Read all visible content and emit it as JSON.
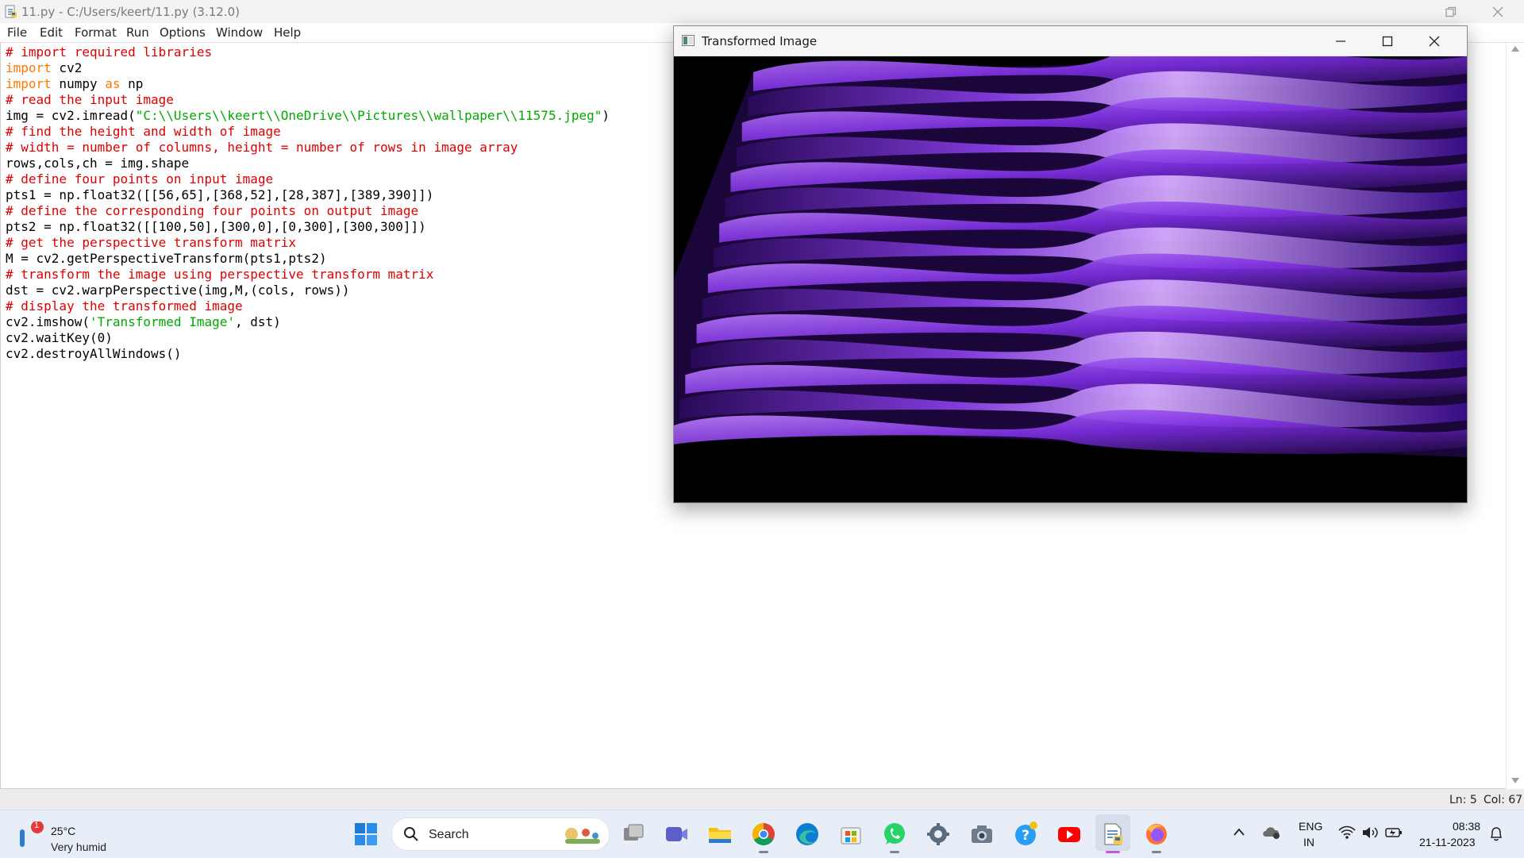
{
  "idle": {
    "title": "11.py - C:/Users/keert/11.py (3.12.0)",
    "menu": [
      "File",
      "Edit",
      "Format",
      "Run",
      "Options",
      "Window",
      "Help"
    ],
    "code": [
      [
        [
          "cmt",
          "# import required libraries"
        ]
      ],
      [
        [
          "kw",
          "import"
        ],
        [
          "txt",
          " cv2"
        ]
      ],
      [
        [
          "kw",
          "import"
        ],
        [
          "txt",
          " numpy "
        ],
        [
          "kw",
          "as"
        ],
        [
          "txt",
          " np"
        ]
      ],
      [
        [
          "cmt",
          "# read the input image"
        ]
      ],
      [
        [
          "txt",
          "img = cv2.imread("
        ],
        [
          "str",
          "\"C:\\\\Users\\\\keert\\\\OneDrive\\\\Pictures\\\\wallpaper\\\\11575.jpeg\""
        ],
        [
          "txt",
          ")"
        ]
      ],
      [
        [
          "cmt",
          "# find the height and width of image"
        ]
      ],
      [
        [
          "cmt",
          "# width = number of columns, height = number of rows in image array"
        ]
      ],
      [
        [
          "txt",
          "rows,cols,ch = img.shape"
        ]
      ],
      [
        [
          "cmt",
          "# define four points on input image"
        ]
      ],
      [
        [
          "txt",
          "pts1 = np.float32([[56,65],[368,52],[28,387],[389,390]])"
        ]
      ],
      [
        [
          "cmt",
          "# define the corresponding four points on output image"
        ]
      ],
      [
        [
          "txt",
          "pts2 = np.float32([[100,50],[300,0],[0,300],[300,300]])"
        ]
      ],
      [
        [
          "cmt",
          "# get the perspective transform matrix"
        ]
      ],
      [
        [
          "txt",
          "M = cv2.getPerspectiveTransform(pts1,pts2)"
        ]
      ],
      [
        [
          "cmt",
          "# transform the image using perspective transform matrix"
        ]
      ],
      [
        [
          "txt",
          "dst = cv2.warpPerspective(img,M,(cols, rows))"
        ]
      ],
      [
        [
          "cmt",
          "# display the transformed image"
        ]
      ],
      [
        [
          "txt",
          "cv2.imshow("
        ],
        [
          "str",
          "'Transformed Image'"
        ],
        [
          "txt",
          ", dst)"
        ]
      ],
      [
        [
          "txt",
          "cv2.waitKey(0)"
        ]
      ],
      [
        [
          "txt",
          "cv2.destroyAllWindows()"
        ]
      ]
    ],
    "status": {
      "ln": "Ln: 5",
      "col": "Col: 67"
    }
  },
  "cv_window": {
    "title": "Transformed Image"
  },
  "taskbar": {
    "weather": {
      "temp": "25°C",
      "condition": "Very humid",
      "badge": "1"
    },
    "search_label": "Search",
    "apps": [
      "start-icon",
      "search-icon",
      "task-view-icon",
      "teams-meet-icon",
      "file-explorer-icon",
      "chrome-icon",
      "edge-icon",
      "microsoft-store-icon",
      "whatsapp-icon",
      "settings-icon",
      "camera-icon",
      "help-icon",
      "youtube-icon",
      "idle-python-icon",
      "firefox-icon"
    ],
    "tray": {
      "lang_top": "ENG",
      "lang_bottom": "IN",
      "time": "08:38",
      "date": "21-11-2023"
    }
  },
  "colors": {
    "comment": "#dd0000",
    "keyword": "#ff7700",
    "string": "#00aa00",
    "taskbar_bg": "#e8eef7"
  }
}
